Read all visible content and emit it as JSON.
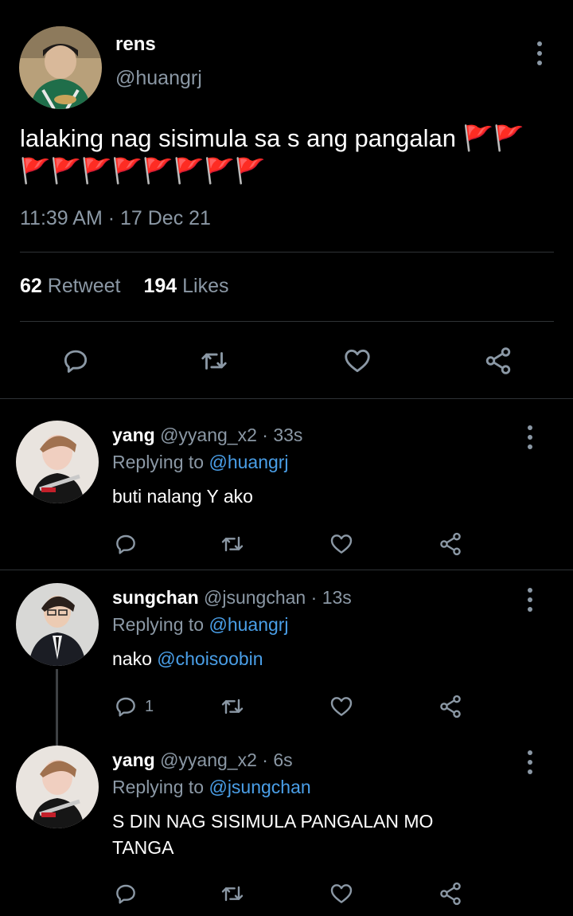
{
  "main_tweet": {
    "name": "rens",
    "handle": "@huangrj",
    "text": "lalaking nag sisimula sa s ang pangalan 🚩🚩🚩🚩🚩🚩🚩🚩🚩🚩",
    "timestamp": "11:39 AM · 17 Dec 21",
    "retweet_count": "62",
    "retweet_label": "Retweet",
    "likes_count": "194",
    "likes_label": "Likes",
    "icons": [
      "reply-icon",
      "retweet-icon",
      "like-icon",
      "share-icon"
    ]
  },
  "replies": [
    {
      "name": "yang",
      "handle": "@yyang_x2",
      "time": "33s",
      "replying_prefix": "Replying to",
      "replying_to": "@huangrj",
      "text": "buti nalang Y ako",
      "mention": "",
      "reply_count": ""
    },
    {
      "name": "sungchan",
      "handle": "@jsungchan",
      "time": "13s",
      "replying_prefix": "Replying to",
      "replying_to": "@huangrj",
      "text": "nako",
      "mention": "@choisoobin",
      "reply_count": "1"
    },
    {
      "name": "yang",
      "handle": "@yyang_x2",
      "time": "6s",
      "replying_prefix": "Replying to",
      "replying_to": "@jsungchan",
      "text": "S DIN NAG SISIMULA PANGALAN MO TANGA",
      "mention": "",
      "reply_count": ""
    }
  ],
  "colors": {
    "background": "#000000",
    "text": "#ffffff",
    "muted": "#8b98a5",
    "link": "#4a9fe8",
    "divider": "#2f3336"
  }
}
